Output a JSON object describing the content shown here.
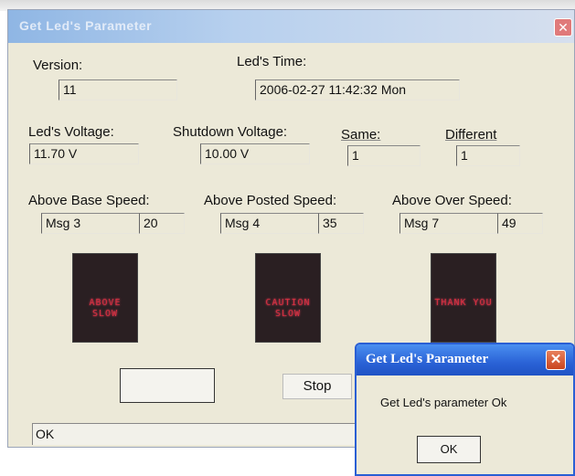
{
  "main_window": {
    "title": "Get Led's Parameter",
    "close_glyph": "✕"
  },
  "fields": {
    "version_label": "Version:",
    "version_value": "11",
    "led_time_label": "Led's Time:",
    "led_time_value": "2006-02-27 11:42:32 Mon",
    "led_voltage_label": "Led's Voltage:",
    "led_voltage_value": "11.70 V",
    "shutdown_voltage_label": "Shutdown Voltage:",
    "shutdown_voltage_value": "10.00 V",
    "same_label": "Same:",
    "same_value": "1",
    "different_label": "Different",
    "different_value": "1"
  },
  "speed": {
    "base_label": "Above Base Speed:",
    "base_msg": "Msg 3",
    "base_value": "20",
    "posted_label": "Above Posted Speed:",
    "posted_msg": "Msg 4",
    "posted_value": "35",
    "over_label": "Above Over Speed:",
    "over_msg": "Msg 7",
    "over_value": "49"
  },
  "signs": {
    "sign1_text": "ABOVE SLOW",
    "sign2_text": "CAUTION SLOW",
    "sign3_text": "THANK YOU"
  },
  "buttons": {
    "blank_label": "",
    "stop_label": "Stop"
  },
  "status": {
    "text": "OK"
  },
  "dialog": {
    "title": "Get Led's Parameter",
    "close_glyph": "✕",
    "message": "Get Led's parameter Ok",
    "ok_label": "OK"
  },
  "colors": {
    "dialog_title_blue": "#2a62d6",
    "led_red": "#d63040"
  }
}
